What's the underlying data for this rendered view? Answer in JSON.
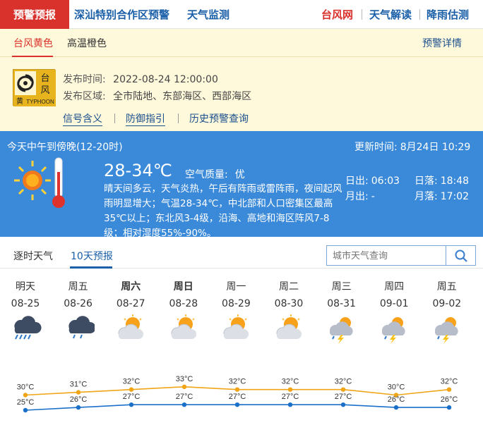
{
  "nav": {
    "active": "预警预报",
    "links": [
      "深汕特别合作区预警",
      "天气监测"
    ],
    "right": [
      {
        "label": "台风网",
        "color": "#d9312b"
      },
      {
        "label": "天气解读",
        "color": "#1a5fa8"
      },
      {
        "label": "降雨估测",
        "color": "#1a5fa8"
      }
    ]
  },
  "warning": {
    "tabs": [
      "台风黄色",
      "高温橙色"
    ],
    "details_link": "预警详情",
    "icon": {
      "text_top": "台",
      "text_mid": "风",
      "text_level": "黄",
      "text_en": "TYPHOON"
    },
    "publish_label": "发布时间:",
    "publish_time": "2022-08-24 12:00:00",
    "area_label": "发布区域:",
    "area": "全市陆地、东部海区、西部海区",
    "links": [
      "信号含义",
      "防御指引",
      "历史预警查询"
    ]
  },
  "today": {
    "period": "今天中午到傍晚(12-20时)",
    "update_label": "更新时间:",
    "update_time": "8月24日 10:29",
    "temp": "28-34℃",
    "aq_label": "空气质量:",
    "aq": "优",
    "description": "晴天间多云，天气炎热，午后有阵雨或雷阵雨，夜间起风雨明显增大；气温28-34℃，中北部和人口密集区最高35℃以上；东北风3-4级，沿海、高地和海区阵风7-8级；相对湿度55%-90%。",
    "sunrise_label": "日出:",
    "sunrise": "06:03",
    "sunset_label": "日落:",
    "sunset": "18:48",
    "moonrise_label": "月出:",
    "moonrise": "-",
    "moonset_label": "月落:",
    "moonset": "17:02"
  },
  "forecast_tabs": [
    "逐时天气",
    "10天预报"
  ],
  "search": {
    "placeholder": "城市天气查询"
  },
  "forecast": [
    {
      "day": "明天",
      "date": "08-25",
      "icon": "heavy-rain-icon",
      "bold": false
    },
    {
      "day": "周五",
      "date": "08-26",
      "icon": "rain-icon",
      "bold": false
    },
    {
      "day": "周六",
      "date": "08-27",
      "icon": "partly-cloudy-icon",
      "bold": true
    },
    {
      "day": "周日",
      "date": "08-28",
      "icon": "partly-cloudy-icon",
      "bold": true
    },
    {
      "day": "周一",
      "date": "08-29",
      "icon": "partly-cloudy-icon",
      "bold": false
    },
    {
      "day": "周二",
      "date": "08-30",
      "icon": "partly-cloudy-icon",
      "bold": false
    },
    {
      "day": "周三",
      "date": "08-31",
      "icon": "thunder-shower-icon",
      "bold": false
    },
    {
      "day": "周四",
      "date": "09-01",
      "icon": "thunder-shower-icon",
      "bold": false
    },
    {
      "day": "周五",
      "date": "09-02",
      "icon": "thunder-shower-icon",
      "bold": false
    }
  ],
  "chart_data": {
    "type": "line",
    "x": [
      "08-25",
      "08-26",
      "08-27",
      "08-28",
      "08-29",
      "08-30",
      "08-31",
      "09-01",
      "09-02"
    ],
    "series": [
      {
        "values": [
          30,
          31,
          32,
          33,
          32,
          32,
          32,
          30,
          32
        ],
        "color": "#f0a416"
      },
      {
        "values": [
          25,
          26,
          27,
          27,
          27,
          27,
          27,
          26,
          26
        ],
        "color": "#1a6fc9"
      }
    ],
    "unit": "°C"
  }
}
